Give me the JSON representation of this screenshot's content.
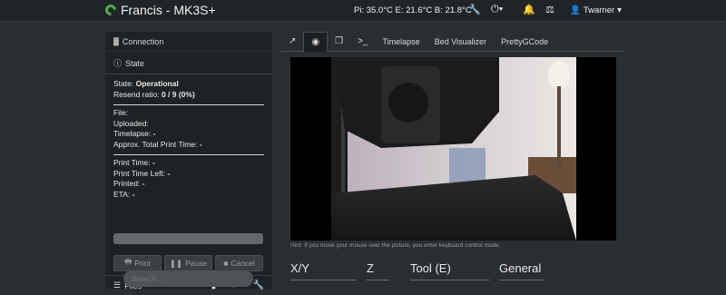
{
  "navbar": {
    "title": "Francis - MK3S+",
    "temps": "Pi: 35.0°C E: 21.6°C B: 21.8°C",
    "user": "Twarner",
    "icons": [
      "wrench-icon",
      "power-icon",
      "bell-icon",
      "system-icon",
      "user-icon"
    ]
  },
  "sidebar": {
    "connection_label": "Connection",
    "state_label": "State",
    "state_prefix": "State:",
    "state_value": "Operational",
    "resend_prefix": "Resend ratio:",
    "resend_value": "0 / 9 (0%)",
    "file": "File:",
    "uploaded": "Uploaded:",
    "timelapse": "Timelapse:",
    "timelapse_value": "-",
    "approx": "Approx. Total Print Time:",
    "approx_value": "-",
    "print_time": "Print Time:",
    "print_time_value": "-",
    "print_time_left": "Print Time Left:",
    "print_time_left_value": "-",
    "printed": "Printed:",
    "printed_value": "-",
    "eta": "ETA:",
    "eta_value": "-",
    "progress": 0,
    "buttons": {
      "print": "Print",
      "pause": "Pause",
      "cancel": "Cancel"
    },
    "files_label": "Files",
    "search_placeholder": "Search..."
  },
  "tabs": [
    "Timelapse",
    "Bed Visualizer",
    "PrettyGCode"
  ],
  "webcam": {
    "hint": "Hint: If you move your mouse over the picture, you enter keyboard control mode."
  },
  "controls": {
    "xy": "X/Y",
    "z": "Z",
    "tool": "Tool (E)",
    "general": "General"
  },
  "colors": {
    "accent": "#4caf50",
    "navbar": "#212426",
    "sidebar": "#1f2224"
  }
}
